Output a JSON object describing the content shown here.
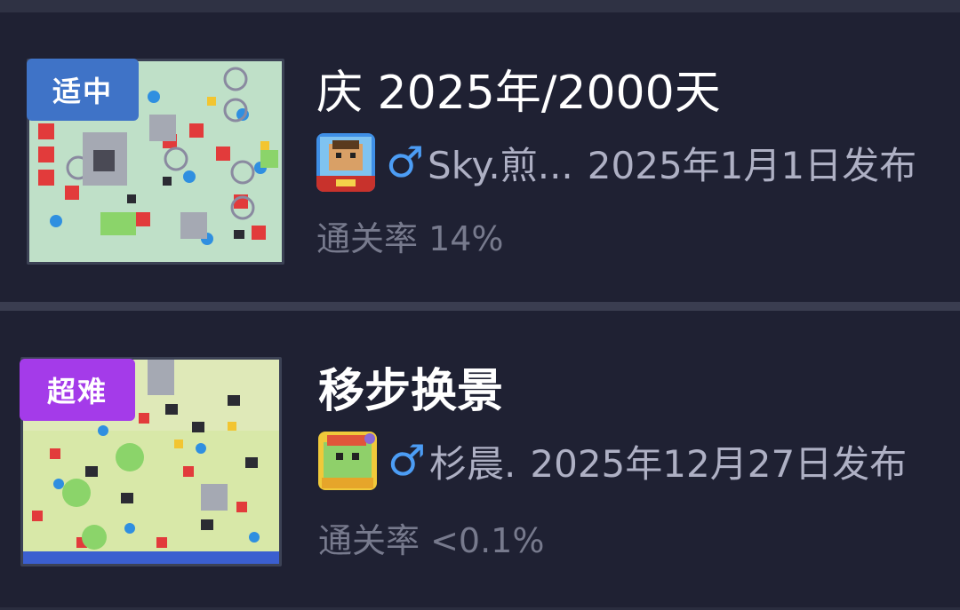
{
  "levels": [
    {
      "difficulty": "适中",
      "title": "庆 2025年/2000天",
      "gender_icon": "male-icon",
      "author": "Sky.煎...",
      "published": "2025年1月1日发布",
      "pass_rate": "通关率 14%",
      "colors": {
        "badge": "#3f73c7"
      }
    },
    {
      "difficulty": "超难",
      "title": "移步换景",
      "gender_icon": "male-icon",
      "author": "杉晨.",
      "published": "2025年12月27日发布",
      "pass_rate": "通关率 <0.1%",
      "colors": {
        "badge": "#a43be9"
      }
    }
  ]
}
